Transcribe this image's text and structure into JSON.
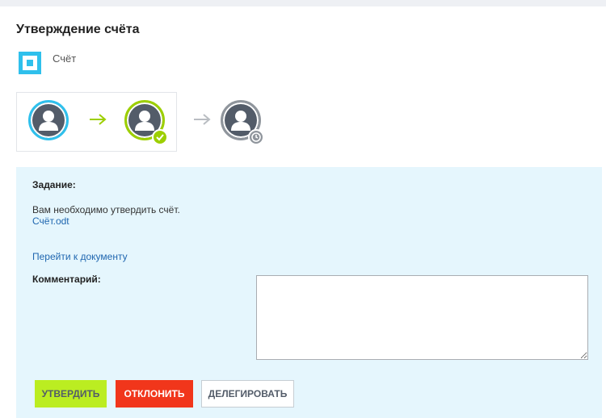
{
  "page": {
    "title": "Утверждение счёта"
  },
  "document": {
    "name": "Счёт",
    "icon": "document-icon",
    "color": "#2fc0ec"
  },
  "workflow": {
    "steps": [
      {
        "icon": "user-avatar-icon",
        "status": "current",
        "ring_color": "#2fc0ec"
      },
      {
        "icon": "user-avatar-icon",
        "status": "approved",
        "ring_color": "#9dcf00",
        "badge_icon": "check-icon"
      },
      {
        "icon": "user-avatar-icon",
        "status": "waiting",
        "ring_color": "#8f959c",
        "badge_icon": "clock-icon"
      }
    ],
    "arrow_colors": [
      "#9dcf00",
      "#b9bdc2"
    ]
  },
  "task": {
    "label": "Задание:",
    "text": "Вам необходимо утвердить счёт.",
    "file_link": "Счёт.odt",
    "document_link": "Перейти к документу",
    "comment_label": "Комментарий:",
    "comment_value": ""
  },
  "actions": {
    "approve": "Утвердить",
    "reject": "Отклонить",
    "delegate": "Делегировать"
  },
  "colors": {
    "panel_bg": "#e5f6fd",
    "approve_bg": "#bbed21",
    "reject_bg": "#f1361b",
    "link": "#2067b0"
  }
}
